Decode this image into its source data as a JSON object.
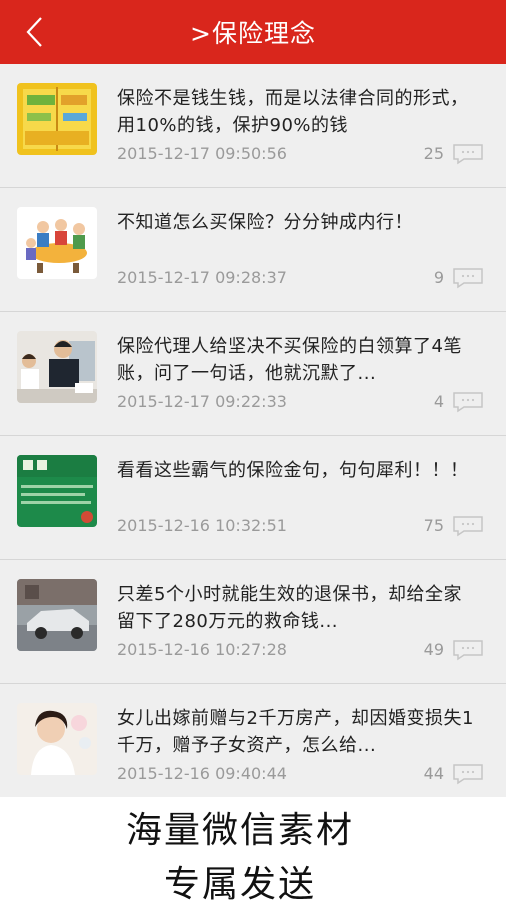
{
  "header": {
    "title": ">保险理念",
    "back_icon": "chevron-left-icon",
    "color": "#d9261c"
  },
  "articles": [
    {
      "title": "保险不是钱生钱，而是以法律合同的形式，用10%的钱，保护90%的钱",
      "date": "2015-12-17 09:50:56",
      "comments": "25",
      "thumb": "yellow-document-image"
    },
    {
      "title": "不知道怎么买保险？分分钟成内行！",
      "date": "2015-12-17 09:28:37",
      "comments": "9",
      "thumb": "meeting-cartoon-image"
    },
    {
      "title": "保险代理人给坚决不买保险的白领算了4笔账，问了一句话，他就沉默了...",
      "date": "2015-12-17 09:22:33",
      "comments": "4",
      "thumb": "office-people-image"
    },
    {
      "title": "看看这些霸气的保险金句，句句犀利！！！",
      "date": "2015-12-16 10:32:51",
      "comments": "75",
      "thumb": "green-banner-image"
    },
    {
      "title": "只差5个小时就能生效的退保书，却给全家留下了280万元的救命钱...",
      "date": "2015-12-16 10:27:28",
      "comments": "49",
      "thumb": "car-accident-image"
    },
    {
      "title": "女儿出嫁前赠与2千万房产，却因婚变损失1千万，赠予子女资产，怎么给...",
      "date": "2015-12-16 09:40:44",
      "comments": "44",
      "thumb": "bride-image"
    }
  ],
  "footer": {
    "line1": "海量微信素材",
    "line2": "专属发送"
  }
}
